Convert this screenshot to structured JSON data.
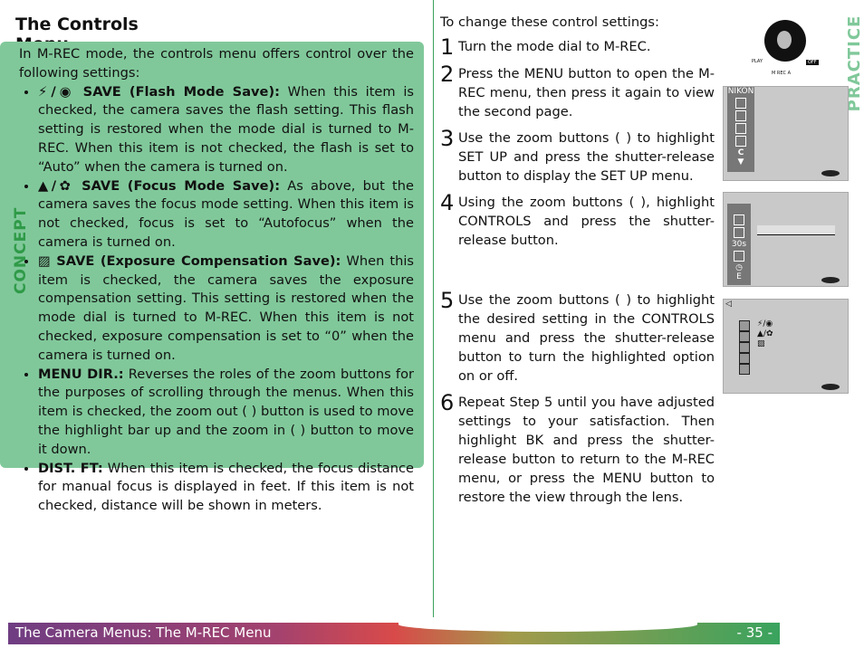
{
  "title": "The Controls Menu",
  "concept": {
    "label": "CONCEPT",
    "intro": "In M-REC mode, the controls menu offers control over the following settings:",
    "items": [
      {
        "term": "⚡/◉ SAVE (Flash Mode Save):",
        "text": " When this item is checked, the camera saves the flash setting.  This flash setting is restored when the mode dial is turned to M-REC.  When this item is not checked, the flash is set to “Auto” when the camera is turned on."
      },
      {
        "term": "▲/✿ SAVE (Focus Mode Save):",
        "text": " As above, but the camera saves the focus mode setting.  When this item is not checked, focus is set to “Autofocus” when the camera is turned on."
      },
      {
        "term": "▨ SAVE (Exposure Compensation Save):",
        "text": " When this item is checked, the camera saves the exposure compensation setting.  This setting is restored when the mode dial is turned to M-REC.  When this item is not checked, exposure compensation is set to “0” when the camera is turned on."
      },
      {
        "term": "MENU DIR.:",
        "text": " Reverses the roles of the zoom buttons for the purposes of scrolling through the menus.  When this item is checked, the zoom out (   ) button is used to move the highlight bar up and the zoom in (   ) button to move it down."
      },
      {
        "term": "DIST. FT:",
        "text": " When this item is checked, the focus distance for manual focus is displayed in feet.  If this item is not checked, distance will be shown in meters."
      }
    ]
  },
  "practice": {
    "label": "PRACTICE",
    "intro": "To change these control settings:",
    "steps": [
      {
        "n": "1",
        "text": "Turn the mode dial to M-REC."
      },
      {
        "n": "2",
        "text": "Press the MENU button to open the M-REC menu, then press it again to view the second page."
      },
      {
        "n": "3",
        "text": "Use the zoom buttons (      ) to highlight SET UP and press the shutter-release button to display the SET UP menu."
      },
      {
        "n": "4",
        "text": "Using the zoom buttons (      ), highlight CONTROLS and press the shutter-release button."
      },
      {
        "n": "5",
        "text": "Use the zoom buttons (      ) to highlight the desired setting in the CONTROLS menu and press the shutter-release button to turn the highlighted option on or off."
      },
      {
        "n": "6",
        "text": "Repeat Step 5 until you have adjusted settings to your satisfaction.  Then highlight BK and press the shutter-release button to return to the M-REC menu, or press the MENU button to restore the view through the lens."
      }
    ]
  },
  "dial": {
    "play": "PLAY",
    "mrec": "M REC A",
    "off": "OFF"
  },
  "screens": {
    "s1_header": "NIKON",
    "s1_c": "C",
    "s2_30s": "30s",
    "s2_e": "E",
    "s3_flash": "⚡/◉",
    "s3_focus": "▲/✿",
    "s3_exp": "▨"
  },
  "footer": {
    "left": "The Camera Menus: The M-REC Menu",
    "right": "- 35 -"
  },
  "colors": {
    "concept_bg": "#80c89a",
    "accent_green": "#3aa35a"
  }
}
